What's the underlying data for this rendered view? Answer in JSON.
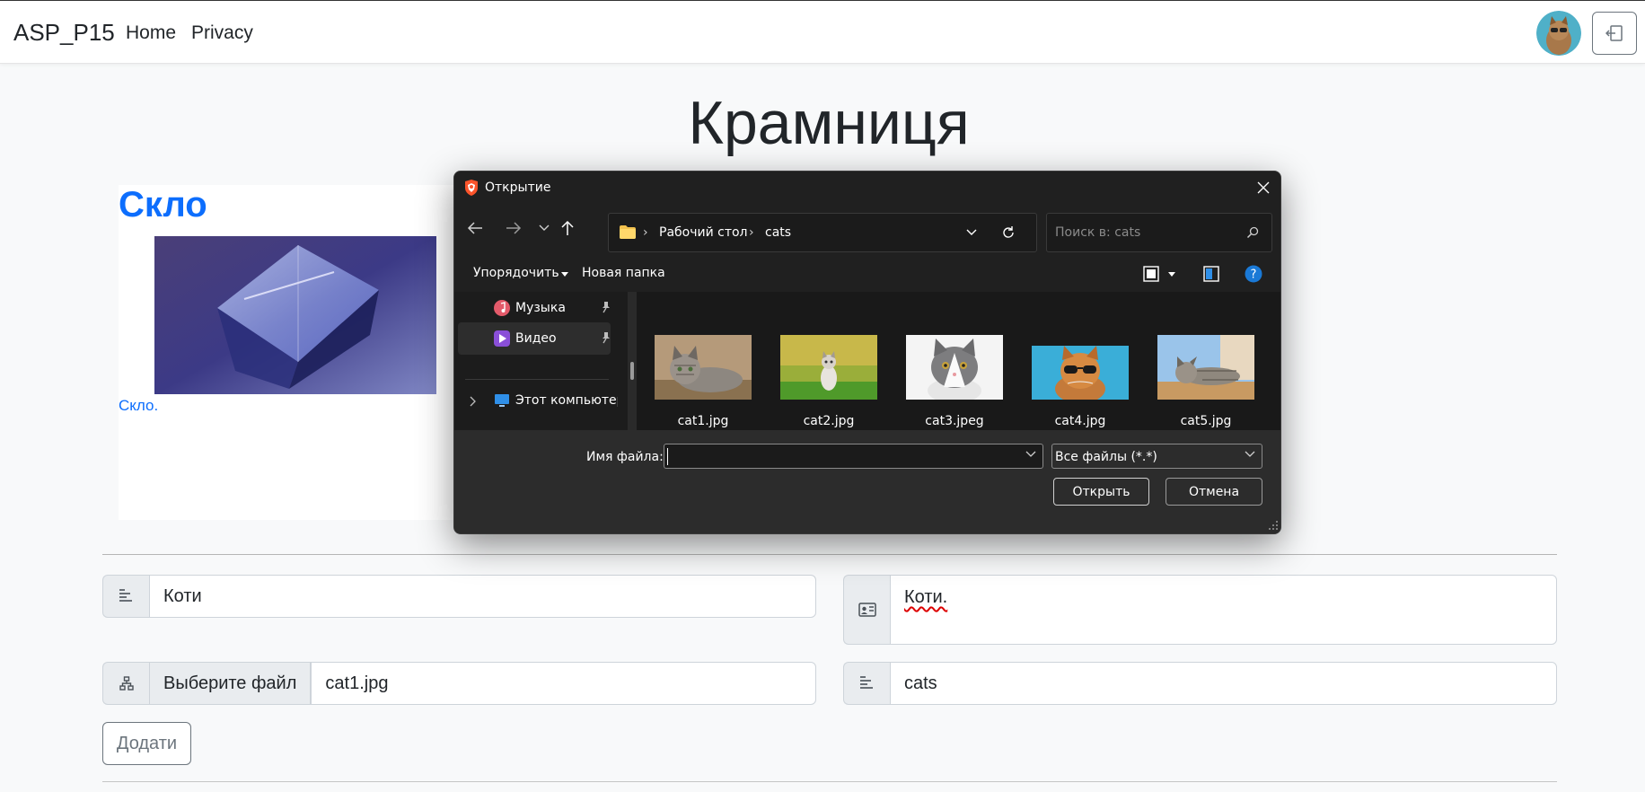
{
  "navbar": {
    "brand": "ASP_P15",
    "links": [
      "Home",
      "Privacy"
    ]
  },
  "page": {
    "title": "Крамниця"
  },
  "card": {
    "title": "Скло",
    "text": "Скло."
  },
  "form": {
    "name_value": "Коти",
    "description_value": "Коти.",
    "file_button": "Выберите файл",
    "file_name": "cat1.jpg",
    "slug_value": "cats",
    "add_button": "Додати"
  },
  "dialog": {
    "title": "Открытие",
    "breadcrumb": [
      "Рабочий стол",
      "cats"
    ],
    "search_placeholder": "Поиск в: cats",
    "toolbar": {
      "organize": "Упорядочить",
      "new_folder": "Новая папка"
    },
    "sidebar": [
      {
        "label": "Музыка",
        "pinned": true,
        "selected": false,
        "icon": "music-icon"
      },
      {
        "label": "Видео",
        "pinned": true,
        "selected": true,
        "icon": "video-icon"
      },
      {
        "label": "Этот компьютер",
        "pinned": false,
        "selected": false,
        "icon": "computer-icon"
      }
    ],
    "files": [
      "cat1.jpg",
      "cat2.jpg",
      "cat3.jpeg",
      "cat4.jpg",
      "cat5.jpg"
    ],
    "filename_label": "Имя файла:",
    "filename_value": "",
    "filetype": "Все файлы (*.*)",
    "open_button": "Открыть",
    "cancel_button": "Отмена"
  },
  "colors": {
    "link_blue": "#0d6efd",
    "dialog_bg": "#1c1c1c",
    "page_bg": "#f8f9fa"
  }
}
